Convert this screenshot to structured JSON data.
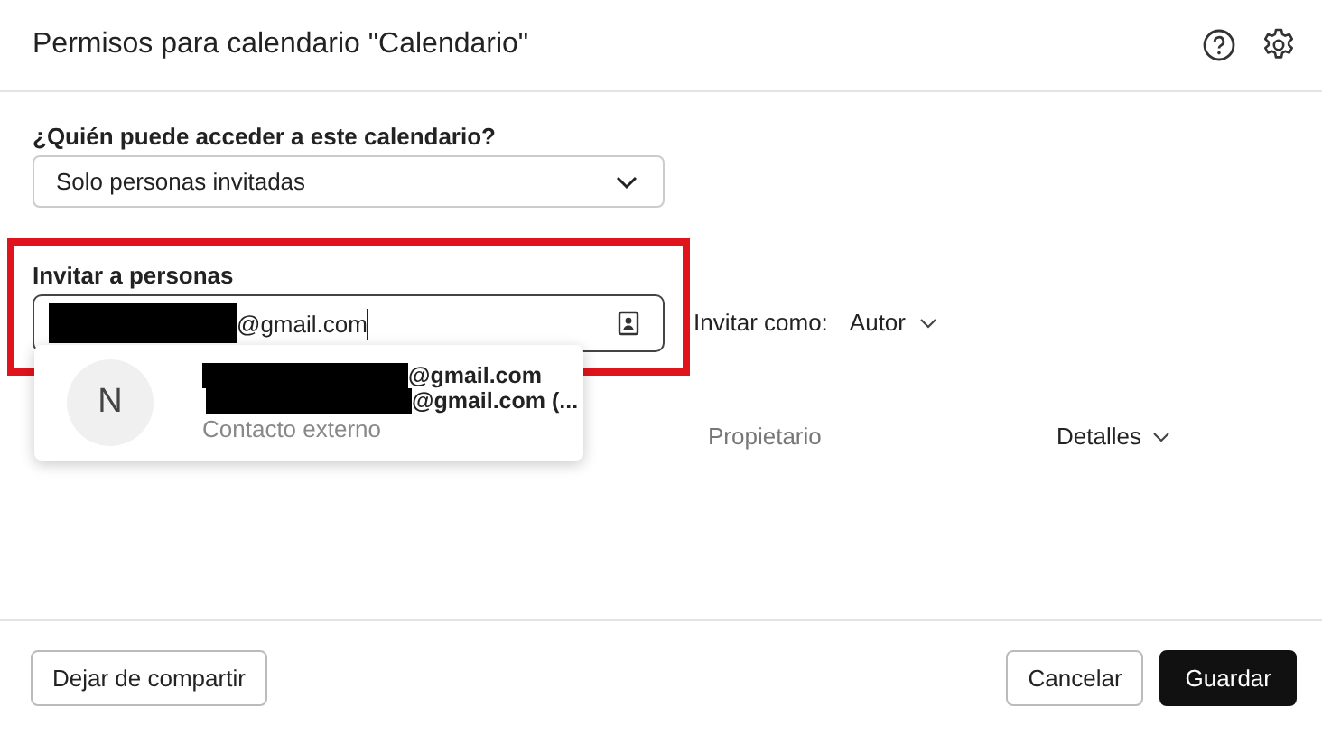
{
  "window": {
    "title": "Permisos para calendario \"Calendario\""
  },
  "access": {
    "label": "¿Quién puede acceder a este calendario?",
    "value": "Solo personas invitadas"
  },
  "invite": {
    "label": "Invitar a personas",
    "value": "@gmail.com",
    "highlighted": true,
    "role_label": "Invitar como:",
    "role": "Autor"
  },
  "suggestions": [
    {
      "initial": "N",
      "lines": [
        "@gmail.com",
        "@gmail.com (..."
      ],
      "subtitle": "Contacto externo"
    }
  ],
  "owner_row": {
    "role": "Propietario",
    "details": "Detalles"
  },
  "buttons": [
    {
      "label": "Dejar de compartir",
      "kind": "secondary"
    },
    {
      "label": "Cancelar",
      "kind": "secondary"
    },
    {
      "label": "Guardar",
      "kind": "primary"
    }
  ]
}
